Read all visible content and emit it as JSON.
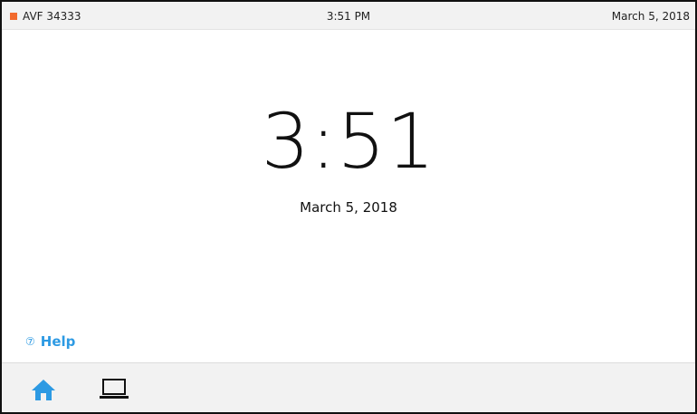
{
  "status_bar": {
    "room_name": "AVF 34333",
    "time": "3:51 PM",
    "date": "March 5, 2018",
    "indicator_color": "#f26a2d"
  },
  "clock": {
    "time": "3:51",
    "date": "March 5, 2018"
  },
  "help": {
    "icon": "help-circle-icon",
    "label": "Help",
    "color": "#2d9ae3"
  },
  "bottom_nav": {
    "items": [
      {
        "icon": "home-icon",
        "active": true,
        "color": "#2d9ae3"
      },
      {
        "icon": "laptop-icon",
        "active": false,
        "color": "#111111"
      }
    ]
  }
}
